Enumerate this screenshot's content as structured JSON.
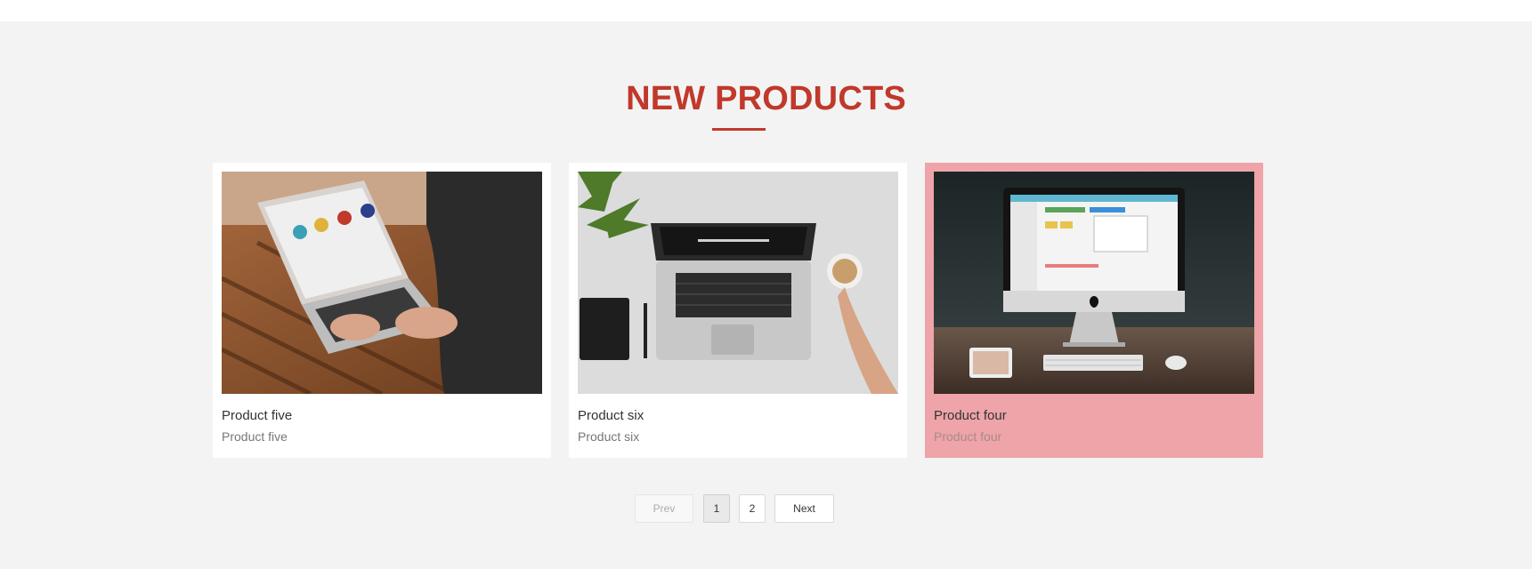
{
  "section": {
    "heading": "NEW PRODUCTS",
    "accent_color": "#c0392b"
  },
  "products": [
    {
      "title": "Product five",
      "subtitle": "Product five",
      "image": "laptop-on-wooden-table-photo"
    },
    {
      "title": "Product six",
      "subtitle": "Product six",
      "image": "laptop-flatlay-with-coffee-photo"
    },
    {
      "title": "Product four",
      "subtitle": "Product four",
      "image": "desktop-computer-on-desk-photo",
      "highlight_color": "#eea4a8"
    }
  ],
  "pagination": {
    "prev_label": "Prev",
    "pages": [
      "1",
      "2"
    ],
    "current_page": "1",
    "next_label": "Next"
  }
}
